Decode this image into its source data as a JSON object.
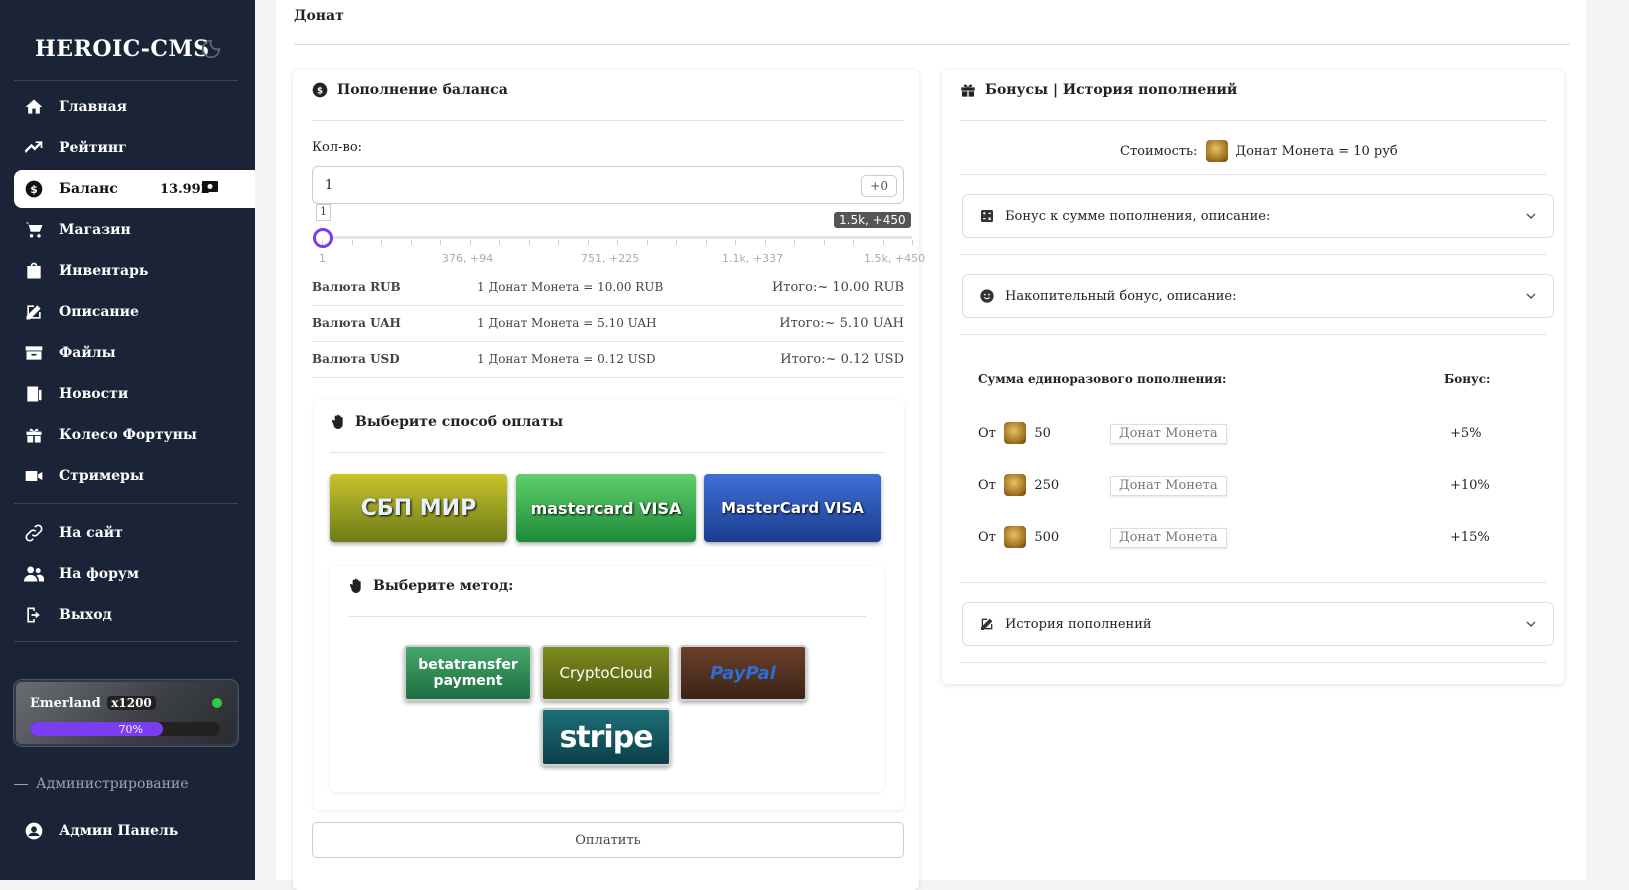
{
  "sidebar": {
    "logo": "HEROIC-CMS",
    "items": [
      {
        "label": "Главная",
        "icon": "home-icon"
      },
      {
        "label": "Рейтинг",
        "icon": "trend-icon"
      },
      {
        "label": "Баланс",
        "icon": "dollar-icon",
        "value": "13.992",
        "active": true
      },
      {
        "label": "Магазин",
        "icon": "cart-icon"
      },
      {
        "label": "Инвентарь",
        "icon": "bag-icon"
      },
      {
        "label": "Описание",
        "icon": "edit-icon"
      },
      {
        "label": "Файлы",
        "icon": "box-icon"
      },
      {
        "label": "Новости",
        "icon": "news-icon"
      },
      {
        "label": "Колесо Фортуны",
        "icon": "gift-icon"
      },
      {
        "label": "Стримеры",
        "icon": "video-icon"
      }
    ],
    "links": [
      {
        "label": "На сайт",
        "icon": "link-icon"
      },
      {
        "label": "На форум",
        "icon": "users-icon"
      },
      {
        "label": "Выход",
        "icon": "logout-icon"
      }
    ],
    "server": {
      "name": "Emerland",
      "rate": "x1200",
      "load": "70%",
      "load_fraction": 0.7
    },
    "admin_heading": "Администрирование",
    "admin_link": "Админ Панель"
  },
  "breadcrumb": "Донат",
  "topup": {
    "title": "Пополнение баланса",
    "qty_label": "Кол-во:",
    "qty_value": "1",
    "qty_bonus": "+0",
    "slider_value": "1",
    "slider_max_label": "1.5k, +450",
    "ticks": [
      "1",
      "376, +94",
      "751, +225",
      "1.1k, +337",
      "1.5k, +450"
    ],
    "currencies": [
      {
        "name": "Валюта RUB",
        "rate": "1 Донат Монета = 10.00 RUB",
        "total": "Итого:~ 10.00 RUB"
      },
      {
        "name": "Валюта UAH",
        "rate": "1 Донат Монета = 5.10 UAH",
        "total": "Итого:~ 5.10 UAH"
      },
      {
        "name": "Валюта USD",
        "rate": "1 Донат Монета = 0.12 USD",
        "total": "Итого:~ 0.12 USD"
      }
    ],
    "pay_title": "Выберите способ оплаты",
    "method_title": "Выберите метод:",
    "pay_options": [
      "СБП МИР",
      "mastercard VISA",
      "MasterCard VISA"
    ],
    "methods": [
      "betatransfer payment",
      "CryptoCloud",
      "PayPal",
      "stripe"
    ],
    "submit": "Оплатить"
  },
  "bonuses": {
    "title": "Бонусы | История пополнений",
    "cost_label": "Стоимость:",
    "cost_value": "Донат Монета = 10 руб",
    "acc1": "Бонус к сумме пополнения, описание:",
    "acc2": "Накопительный бонус, описание:",
    "acc3": "История пополнений",
    "table_head_sum": "Сумма единоразового пополнения:",
    "table_head_bonus": "Бонус:",
    "rows": [
      {
        "from": "От",
        "amount": "50",
        "coin": "Донат Монета",
        "bonus": "+5%"
      },
      {
        "from": "От",
        "amount": "250",
        "coin": "Донат Монета",
        "bonus": "+10%"
      },
      {
        "from": "От",
        "amount": "500",
        "coin": "Донат Монета",
        "bonus": "+15%"
      }
    ]
  }
}
